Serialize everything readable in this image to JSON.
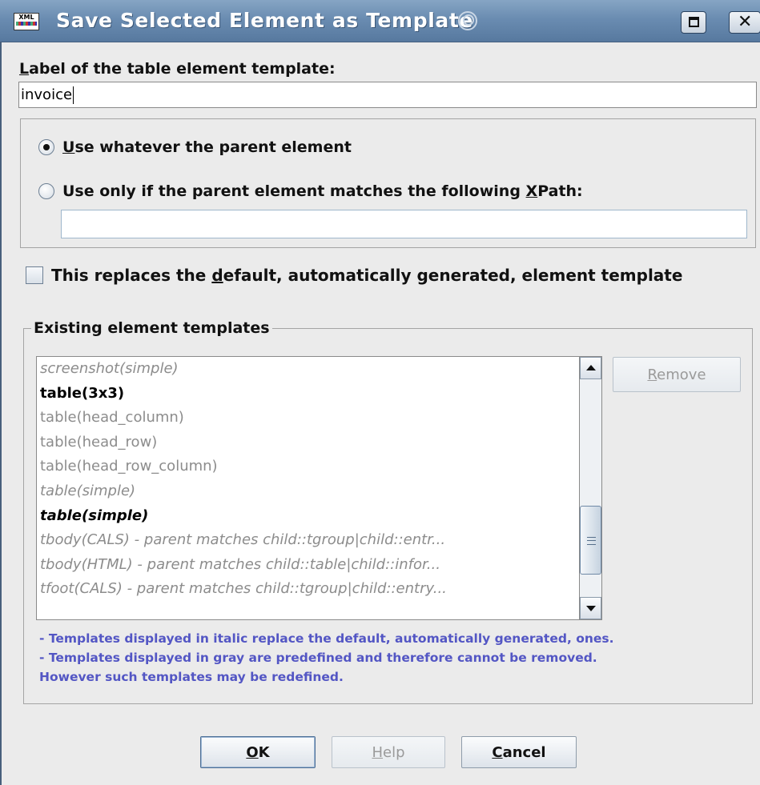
{
  "window": {
    "title": "Save Selected Element as Template",
    "icon_name": "xml-app-icon",
    "icon_text": "XML",
    "accent": "#6a8cb1"
  },
  "label_field": {
    "label_prefix": "L",
    "label_rest": "abel of the table element template:",
    "value": "invoice"
  },
  "parent_options": {
    "option1_underlined": "U",
    "option1_rest": "se whatever the parent element",
    "option1_selected": true,
    "option2_prefix": "Use only if the parent element matches the following ",
    "option2_underlined": "X",
    "option2_suffix": "Path:",
    "option2_selected": false,
    "xpath_value": ""
  },
  "replace_default": {
    "prefix": "This replaces the ",
    "underlined": "d",
    "suffix": "efault, automatically generated, element template",
    "checked": false
  },
  "existing": {
    "legend": "Existing element templates",
    "items": [
      {
        "text": "screenshot(simple)",
        "style": "gray italic"
      },
      {
        "text": "table(3x3)",
        "style": "black bold"
      },
      {
        "text": "table(head_column)",
        "style": "gray"
      },
      {
        "text": "table(head_row)",
        "style": "gray"
      },
      {
        "text": "table(head_row_column)",
        "style": "gray"
      },
      {
        "text": "table(simple)",
        "style": "gray italic"
      },
      {
        "text": "table(simple)",
        "style": "black bold italic"
      },
      {
        "text": "tbody(CALS) - parent matches child::tgroup|child::entr...",
        "style": "gray italic"
      },
      {
        "text": "tbody(HTML) - parent matches child::table|child::infor...",
        "style": "gray italic"
      },
      {
        "text": "tfoot(CALS) - parent matches child::tgroup|child::entry...",
        "style": "gray italic"
      }
    ],
    "remove_underlined": "R",
    "remove_rest": "emove",
    "notes": [
      "- Templates displayed in italic replace the default, automatically generated, ones.",
      "- Templates displayed in gray are predefined and therefore cannot be removed.",
      "However such templates may be redefined."
    ]
  },
  "buttons": {
    "ok_underlined": "O",
    "ok_rest": "K",
    "help_underlined": "H",
    "help_rest": "elp",
    "cancel_underlined": "C",
    "cancel_rest": "ancel"
  }
}
